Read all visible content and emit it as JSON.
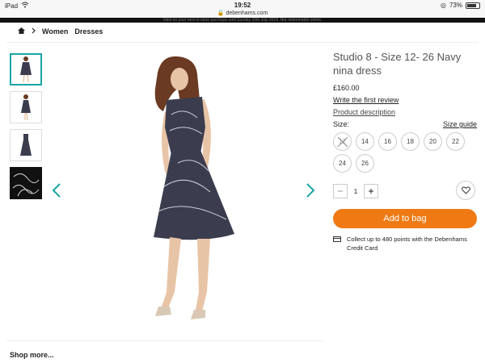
{
  "status_bar": {
    "device": "iPad",
    "time": "19:52",
    "url": "debenhams.com",
    "battery": "73%"
  },
  "promo_text": "Valid on your next in-store purchase until Sunday 15th July 2018. Not redeemable online.",
  "breadcrumb": {
    "items": [
      "Women",
      "Dresses"
    ]
  },
  "product": {
    "title": "Studio 8 - Size 12- 26 Navy nina dress",
    "price": "£160.00",
    "review_link": "Write the first review",
    "description_link": "Product description",
    "size_label": "Size:",
    "size_guide": "Size guide",
    "sizes": [
      {
        "label": "12",
        "available": false
      },
      {
        "label": "14",
        "available": true
      },
      {
        "label": "16",
        "available": true
      },
      {
        "label": "18",
        "available": true
      },
      {
        "label": "20",
        "available": true
      },
      {
        "label": "22",
        "available": true
      },
      {
        "label": "24",
        "available": true
      },
      {
        "label": "26",
        "available": true
      }
    ],
    "quantity": "1",
    "add_to_bag": "Add to bag",
    "credit_text": "Collect up to 480 points with the Debenhams Credit Card"
  },
  "shop_more": "Shop more...",
  "colors": {
    "accent": "#1aa5a5",
    "cta": "#ef7a14",
    "dress": "#3b3d4f"
  }
}
